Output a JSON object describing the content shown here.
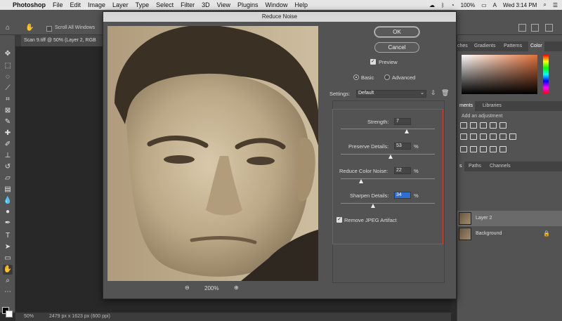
{
  "menubar": {
    "app": "Photoshop",
    "items": [
      "File",
      "Edit",
      "Image",
      "Layer",
      "Type",
      "Select",
      "Filter",
      "3D",
      "View",
      "Plugins",
      "Window",
      "Help"
    ],
    "battery": "100%",
    "clock": "Wed 3:14 PM"
  },
  "optionsbar": {
    "scroll_all_windows": "Scroll All Windows"
  },
  "document_tab": {
    "label": "Scan 9.tiff @ 50% (Layer 2, RGB"
  },
  "statusbar": {
    "zoom": "50%",
    "dims": "2479 px x 1623 px (600 ppi)"
  },
  "panels": {
    "color_tabs": [
      "ches",
      "Gradients",
      "Patterns",
      "Color"
    ],
    "adjust_tabs": [
      "ments",
      "Libraries"
    ],
    "adjust_label": "Add an adjustment",
    "layers_tabs": [
      "s",
      "Paths",
      "Channels"
    ],
    "layers": [
      "Layer 2",
      "Background"
    ]
  },
  "dialog": {
    "title": "Reduce Noise",
    "ok": "OK",
    "cancel": "Cancel",
    "preview": "Preview",
    "mode_basic": "Basic",
    "mode_advanced": "Advanced",
    "settings_label": "Settings:",
    "settings_value": "Default",
    "zoom": "200%",
    "strength_label": "Strength:",
    "strength_value": "7",
    "strength_level": 0.7,
    "preserve_label": "Preserve Details:",
    "preserve_value": "53",
    "preserve_level": 0.53,
    "color_noise_label": "Reduce Color Noise:",
    "color_noise_value": "22",
    "color_noise_level": 0.22,
    "sharpen_label": "Sharpen Details:",
    "sharpen_value": "34",
    "sharpen_level": 0.34,
    "percent": "%",
    "jpeg_label": "Remove JPEG Artifact"
  }
}
